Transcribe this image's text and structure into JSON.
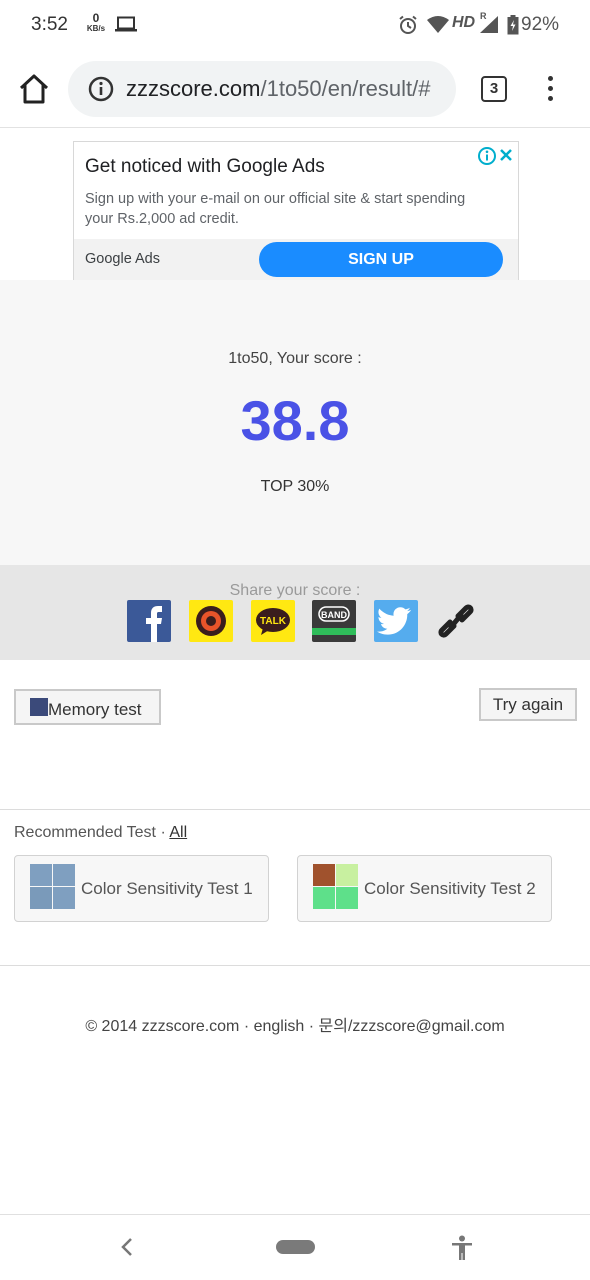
{
  "status_bar": {
    "time": "3:52",
    "net_speed_value": "0",
    "net_speed_unit": "KB/s",
    "network_type": "HD",
    "roaming": "R",
    "battery": "92%",
    "icons": [
      "laptop-icon",
      "alarm-icon",
      "wifi-icon",
      "signal-icon",
      "battery-icon"
    ]
  },
  "browser": {
    "url_host": "zzzscore.com",
    "url_path": "/1to50/en/result/#",
    "tab_count": "3",
    "icons": [
      "home-icon",
      "info-icon",
      "menu-icon"
    ]
  },
  "ad": {
    "title": "Get noticed with Google Ads",
    "body": "Sign up with your e-mail on our official site & start spending your Rs.2,000 ad credit.",
    "brand": "Google Ads",
    "cta": "SIGN UP",
    "cta_color": "#1a8cff"
  },
  "result": {
    "label": "1to50, Your score :",
    "score": "38.8",
    "rank": "TOP 30%",
    "score_color": "#4a52e6"
  },
  "share": {
    "label": "Share your score :",
    "platforms": [
      "facebook",
      "kakaostory",
      "kakaotalk",
      "band",
      "twitter",
      "copy-link"
    ],
    "talk_label": "TALK",
    "band_label": "BAND"
  },
  "actions": {
    "memory_test": "Memory test",
    "try_again": "Try again"
  },
  "recommended": {
    "label": "Recommended Test · ",
    "all_link": "All",
    "items": [
      {
        "title": "Color Sensitivity Test 1"
      },
      {
        "title": "Color Sensitivity Test 2"
      }
    ]
  },
  "footer": {
    "text": "© 2014 zzzscore.com · english · 문의/zzzscore@gmail.com"
  }
}
